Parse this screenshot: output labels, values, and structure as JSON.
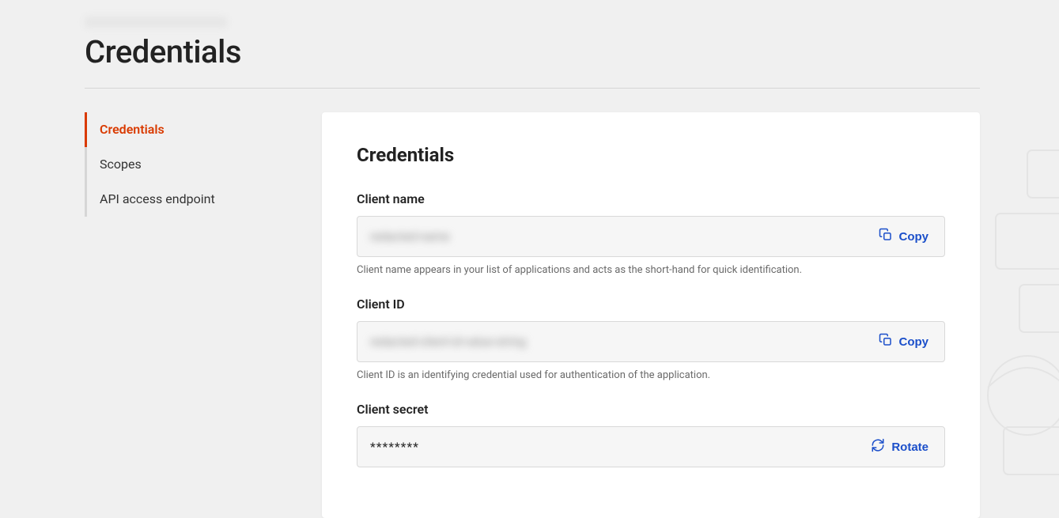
{
  "page": {
    "title": "Credentials"
  },
  "sidebar": {
    "items": [
      {
        "label": "Credentials",
        "active": true
      },
      {
        "label": "Scopes",
        "active": false
      },
      {
        "label": "API access endpoint",
        "active": false
      }
    ]
  },
  "panel": {
    "title": "Credentials",
    "fields": {
      "client_name": {
        "label": "Client name",
        "value": "redacted-name",
        "helper": "Client name appears in your list of applications and acts as the short-hand for quick identification.",
        "action": "Copy"
      },
      "client_id": {
        "label": "Client ID",
        "value": "redacted-client-id-value-string",
        "helper": "Client ID is an identifying credential used for authentication of the application.",
        "action": "Copy"
      },
      "client_secret": {
        "label": "Client secret",
        "value": "********",
        "action": "Rotate"
      }
    }
  }
}
